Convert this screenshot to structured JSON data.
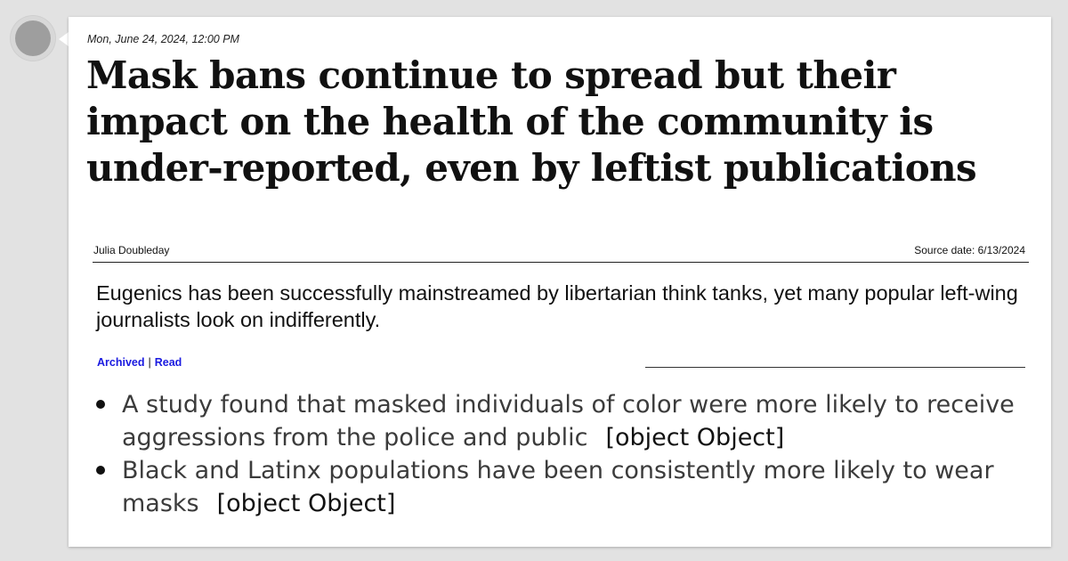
{
  "post": {
    "timestamp": "Mon, June 24, 2024, 12:00 PM",
    "headline": "Mask bans continue to spread but their impact on the health of the community is under-reported, even by leftist publications",
    "author": "Julia Doubleday",
    "source_date": "Source date: 6/13/2024",
    "summary": "Eugenics has been successfully mainstreamed by libertarian think tanks, yet many popular left-wing journalists look on indifferently.",
    "links": {
      "archived": "Archived",
      "separator": "|",
      "read": "Read"
    },
    "points": [
      {
        "text": "A study found that masked individuals of color were more likely to receive aggressions from the police and public",
        "ref": "[object Object]"
      },
      {
        "text": "Black and Latinx populations have been consistently more likely to wear masks",
        "ref": "[object Object]"
      }
    ]
  },
  "colors": {
    "background": "#e2e2e2",
    "card": "#ffffff",
    "link": "#1a1ae0",
    "avatar": "#9e9e9e"
  }
}
